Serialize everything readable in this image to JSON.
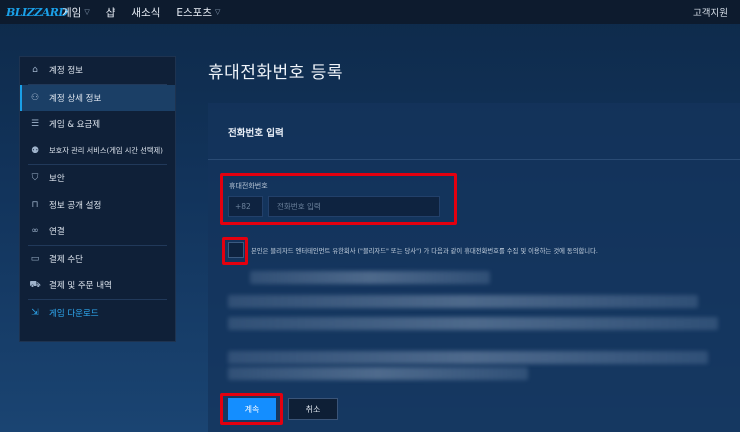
{
  "nav": {
    "logo": "BLIZZARD",
    "items": [
      {
        "label": "게임",
        "has_dropdown": true
      },
      {
        "label": "샵",
        "has_dropdown": false
      },
      {
        "label": "새소식",
        "has_dropdown": false
      },
      {
        "label": "E스포츠",
        "has_dropdown": true
      }
    ],
    "support": "고객지원"
  },
  "sidebar": {
    "items": [
      {
        "label": "계정 정보",
        "icon": "home-icon"
      },
      {
        "label": "계정 상세 정보",
        "icon": "user-icon",
        "active": true
      },
      {
        "label": "게임 & 요금제",
        "icon": "list-icon"
      },
      {
        "label": "보호자 관리 서비스(게임 시간 선택제)",
        "icon": "users-icon"
      },
      {
        "label": "보안",
        "icon": "shield-icon"
      },
      {
        "label": "정보 공개 설정",
        "icon": "lock-icon"
      },
      {
        "label": "연결",
        "icon": "link-icon"
      },
      {
        "label": "결제 수단",
        "icon": "card-icon"
      },
      {
        "label": "결제 및 주문 내역",
        "icon": "cart-icon"
      },
      {
        "label": "게임 다운로드",
        "icon": "download-icon"
      }
    ]
  },
  "main": {
    "title": "휴대전화번호 등록",
    "section_title": "전화번호 입력",
    "field_label": "휴대전화번호",
    "country_code": "+82",
    "phone_placeholder": "전화번호 입력",
    "phone_value": "",
    "consent_text": "본인은 블리자드 엔터테인먼트 유한회사 (\"블리자드\" 또는 당사\") 가 다음과 같이 휴대전화번호를 수집 및 이용하는 것에 동의합니다.",
    "consent_checked": false,
    "continue_label": "계속",
    "cancel_label": "취소"
  },
  "colors": {
    "accent": "#148eff",
    "highlight": "#e3000f",
    "nav_bg": "#0d1b2e",
    "sidebar_bg": "#0f2038"
  }
}
